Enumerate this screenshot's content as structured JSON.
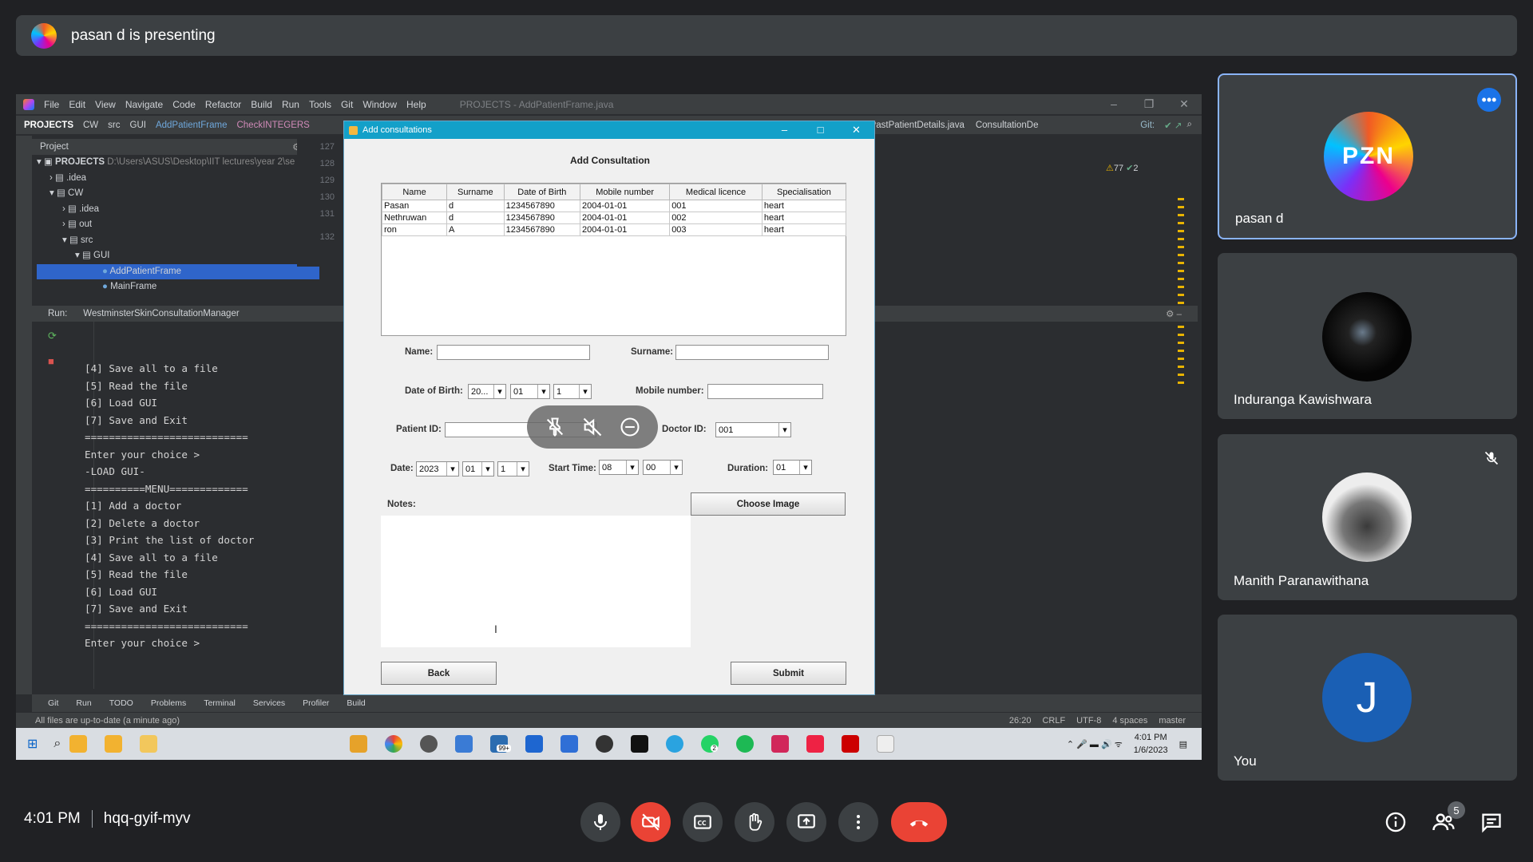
{
  "banner": {
    "text": "pasan d is presenting"
  },
  "ide": {
    "menu": [
      "File",
      "Edit",
      "View",
      "Navigate",
      "Code",
      "Refactor",
      "Build",
      "Run",
      "Tools",
      "Git",
      "Window",
      "Help"
    ],
    "window_title": "PROJECTS - AddPatientFrame.java",
    "breadcrumb": [
      "PROJECTS",
      "CW",
      "src",
      "GUI",
      "AddPatientFrame",
      "CheckINTEGERS"
    ],
    "tabs": [
      "ViewPastPatientDetails.java",
      "ConsultationDe"
    ],
    "git_label": "Git:",
    "project_header": "Project",
    "tree": [
      {
        "label": "PROJECTS",
        "path": "D:\\Users\\ASUS\\Desktop\\IIT lectures\\year 2\\se"
      },
      {
        "label": ".idea"
      },
      {
        "label": "CW"
      },
      {
        "label": ".idea"
      },
      {
        "label": "out"
      },
      {
        "label": "src"
      },
      {
        "label": "GUI"
      },
      {
        "label": "AddPatientFrame"
      },
      {
        "label": "MainFrame"
      }
    ],
    "line_numbers": [
      "127",
      "128",
      "129",
      "130",
      "131",
      "132"
    ],
    "warnings": "77",
    "checks": "2",
    "run_label": "Run:",
    "run_config": "WestminsterSkinConsultationManager",
    "console_lines": [
      "[4] Save all to a file",
      "[5] Read the file",
      "[6] Load GUI",
      "[7] Save and Exit",
      "===========================",
      "",
      "Enter your choice >",
      "",
      "-LOAD GUI-",
      "",
      "==========MENU=============",
      "[1] Add a doctor",
      "[2] Delete a doctor",
      "[3] Print the list of doctor",
      "[4] Save all to a file",
      "[5] Read the file",
      "[6] Load GUI",
      "[7] Save and Exit",
      "===========================",
      "",
      "Enter your choice >"
    ],
    "bottom_tabs": [
      "Git",
      "Run",
      "TODO",
      "Problems",
      "Terminal",
      "Services",
      "Profiler",
      "Build"
    ],
    "status_left": "All files are up-to-date (a minute ago)",
    "status_right": [
      "26:20",
      "CRLF",
      "UTF-8",
      "4 spaces",
      "master"
    ]
  },
  "taskbar": {
    "time": "4:01 PM",
    "date": "1/6/2023",
    "mail_badge": "99+",
    "whatsapp_badge": "2"
  },
  "dialog": {
    "window_title": "Add consultations",
    "heading": "Add Consultation",
    "table": {
      "columns": [
        "Name",
        "Surname",
        "Date of Birth",
        "Mobile number",
        "Medical licence",
        "Specialisation"
      ],
      "rows": [
        [
          "Pasan",
          "d",
          "1234567890",
          "2004-01-01",
          "001",
          "heart"
        ],
        [
          "Nethruwan",
          "d",
          "1234567890",
          "2004-01-01",
          "002",
          "heart"
        ],
        [
          "ron",
          "A",
          "1234567890",
          "2004-01-01",
          "003",
          "heart"
        ]
      ]
    },
    "name_label": "Name:",
    "surname_label": "Surname:",
    "dob_label": "Date of Birth:",
    "dob_year": "20...",
    "dob_month": "01",
    "dob_day": "1",
    "mobile_label": "Mobile number:",
    "patient_id_label": "Patient ID:",
    "doctor_id_label": "Doctor ID:",
    "doctor_id": "001",
    "date_label": "Date:",
    "date_year": "2023",
    "date_month": "01",
    "date_day": "1",
    "start_time_label": "Start Time:",
    "start_hour": "08",
    "start_min": "00",
    "duration_label": "Duration:",
    "duration": "01",
    "notes_label": "Notes:",
    "choose_image": "Choose Image",
    "back": "Back",
    "submit": "Submit"
  },
  "participants": [
    {
      "name": "pasan d",
      "avatar_text": "PZN"
    },
    {
      "name": "Induranga Kawishwara"
    },
    {
      "name": "Manith Paranawithana"
    },
    {
      "name": "You",
      "initial": "J"
    }
  ],
  "meeting": {
    "time": "4:01 PM",
    "code": "hqq-gyif-myv",
    "people_count": "5"
  },
  "colors": {
    "end_call": "#ea4335",
    "accent_blue": "#8ab4f8",
    "you_avatar": "#1a5fb4",
    "more_button": "#1a73e8"
  }
}
